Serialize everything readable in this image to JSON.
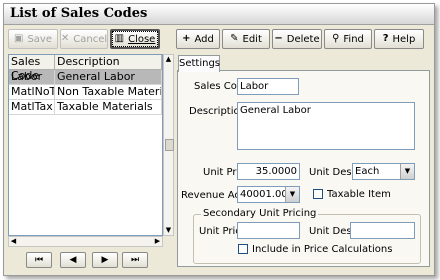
{
  "window": {
    "title": "List of Sales Codes"
  },
  "toolbar": {
    "save": "Save",
    "cancel": "Cancel",
    "close": "Close",
    "add": "Add",
    "edit": "Edit",
    "delete": "Delete",
    "find": "Find",
    "help": "Help"
  },
  "grid": {
    "headers": [
      "Sales Code",
      "Description"
    ],
    "rows": [
      {
        "code": "Labor",
        "description": "General Labor"
      },
      {
        "code": "MatlNoTx",
        "description": "Non Taxable Materials"
      },
      {
        "code": "MatlTax",
        "description": "Taxable Materials"
      }
    ]
  },
  "tabs": [
    "Settings"
  ],
  "form": {
    "sales_code_label": "Sales Code:",
    "sales_code": "Labor",
    "description_label": "Description:",
    "description": "General Labor",
    "unit_price_label": "Unit Price:",
    "unit_price": "35.0000",
    "unit_desc_label": "Unit Desc:",
    "unit_desc": "Each",
    "revenue_acct_label": "Revenue Acct:",
    "revenue_acct": "40001.00",
    "taxable_label": "Taxable Item",
    "taxable_checked": false,
    "secondary_title": "Secondary Unit Pricing",
    "sec_unit_price_label": "Unit Price:",
    "sec_unit_price": "",
    "sec_unit_desc_label": "Unit Desc:",
    "sec_unit_desc": "",
    "include_label": "Include in Price Calculations",
    "include_checked": false
  },
  "icons": {
    "save": "floppy-disk-icon",
    "cancel": "x-icon",
    "close": "door-icon",
    "add": "plus-icon",
    "edit": "pencil-icon",
    "delete": "minus-icon",
    "find": "flashlight-icon",
    "help": "question-icon",
    "nav": [
      "first-record-icon",
      "previous-record-icon",
      "next-record-icon",
      "last-record-icon"
    ]
  }
}
